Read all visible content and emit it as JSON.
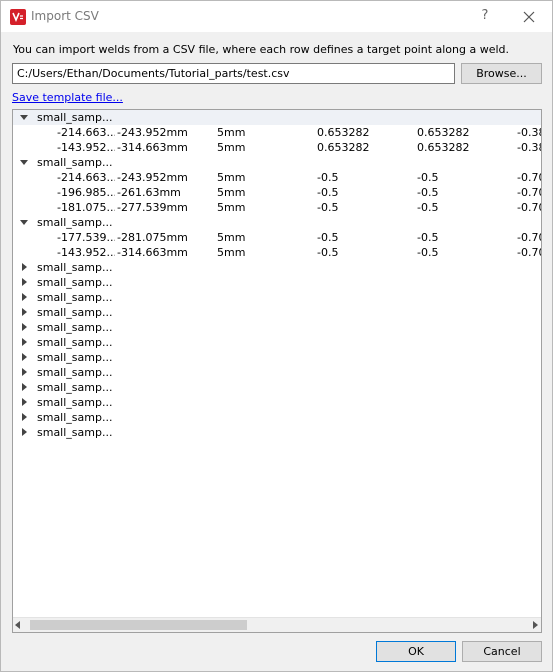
{
  "window": {
    "title": "Import CSV",
    "help_label": "?",
    "icon_name": "app-logo-icon",
    "close_icon": "close-icon"
  },
  "description": "You can import welds from a CSV file, where each row defines a target point along a weld.",
  "file_path": "C:/Users/Ethan/Documents/Tutorial_parts/test.csv",
  "browse_label": "Browse...",
  "template_link": "Save template file...",
  "tree": {
    "groups": [
      {
        "label": "small_samp...",
        "expanded": true,
        "rows": [
          [
            "-214.663...",
            "-243.952mm",
            "5mm",
            "0.653282",
            "0.653282",
            "-0.38"
          ],
          [
            "-143.952...",
            "-314.663mm",
            "5mm",
            "0.653282",
            "0.653282",
            "-0.38"
          ]
        ]
      },
      {
        "label": "small_samp...",
        "expanded": true,
        "rows": [
          [
            "-214.663...",
            "-243.952mm",
            "5mm",
            "-0.5",
            "-0.5",
            "-0.70"
          ],
          [
            "-196.985...",
            "-261.63mm",
            "5mm",
            "-0.5",
            "-0.5",
            "-0.70"
          ],
          [
            "-181.075...",
            "-277.539mm",
            "5mm",
            "-0.5",
            "-0.5",
            "-0.70"
          ]
        ]
      },
      {
        "label": "small_samp...",
        "expanded": true,
        "rows": [
          [
            "-177.539...",
            "-281.075mm",
            "5mm",
            "-0.5",
            "-0.5",
            "-0.70"
          ],
          [
            "-143.952...",
            "-314.663mm",
            "5mm",
            "-0.5",
            "-0.5",
            "-0.70"
          ]
        ]
      },
      {
        "label": "small_samp...",
        "expanded": false,
        "rows": []
      },
      {
        "label": "small_samp...",
        "expanded": false,
        "rows": []
      },
      {
        "label": "small_samp...",
        "expanded": false,
        "rows": []
      },
      {
        "label": "small_samp...",
        "expanded": false,
        "rows": []
      },
      {
        "label": "small_samp...",
        "expanded": false,
        "rows": []
      },
      {
        "label": "small_samp...",
        "expanded": false,
        "rows": []
      },
      {
        "label": "small_samp...",
        "expanded": false,
        "rows": []
      },
      {
        "label": "small_samp...",
        "expanded": false,
        "rows": []
      },
      {
        "label": "small_samp...",
        "expanded": false,
        "rows": []
      },
      {
        "label": "small_samp...",
        "expanded": false,
        "rows": []
      },
      {
        "label": "small_samp...",
        "expanded": false,
        "rows": []
      },
      {
        "label": "small_samp...",
        "expanded": false,
        "rows": []
      }
    ]
  },
  "buttons": {
    "ok": "OK",
    "cancel": "Cancel"
  },
  "colors": {
    "accent": "#0078d7",
    "link": "#0000ee",
    "app_icon": "#d4202a"
  }
}
